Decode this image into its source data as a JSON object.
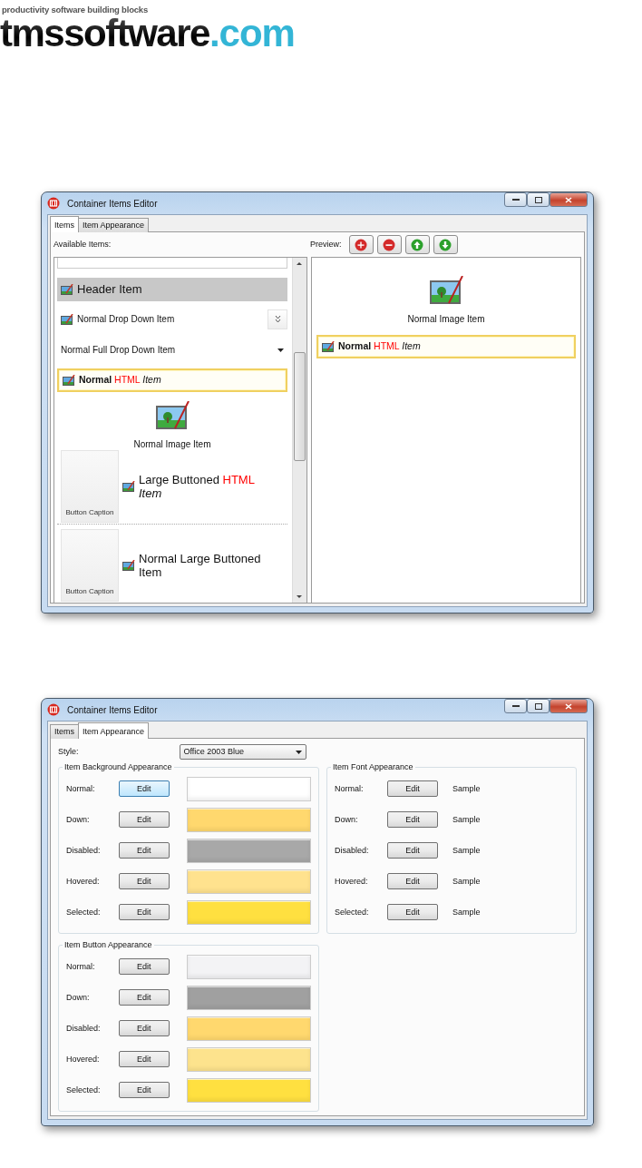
{
  "logo": {
    "tagline": "productivity software building blocks",
    "name": "tmssoftware",
    "suffix": ".com"
  },
  "windows": [
    {
      "kind": "items",
      "title": "Container Items Editor",
      "tabs": [
        {
          "label": "Items",
          "selected": true
        },
        {
          "label": "Item Appearance",
          "selected": false
        }
      ],
      "available_label": "Available Items:",
      "preview_label": "Preview:",
      "preview_buttons": [
        {
          "kind": "add"
        },
        {
          "kind": "remove"
        },
        {
          "kind": "up"
        },
        {
          "kind": "down"
        }
      ],
      "list_items": [
        {
          "kind": "header",
          "selected": false,
          "parts": [
            {
              "text": "Header Item"
            }
          ]
        },
        {
          "kind": "dropdown",
          "selected": false,
          "parts": [
            {
              "text": "Normal Drop Down Item"
            }
          ]
        },
        {
          "kind": "full-dropdown",
          "selected": false,
          "parts": [
            {
              "text": "Normal Full Drop Down Item"
            }
          ]
        },
        {
          "kind": "text",
          "selected": true,
          "parts": [
            {
              "text": "**Normal**"
            },
            {
              "text": "HTML",
              "color": "#ff0000"
            },
            {
              "text": "*Item*"
            }
          ]
        },
        {
          "kind": "image",
          "selected": false,
          "parts": [
            {
              "text": "Normal Image Item"
            }
          ]
        },
        {
          "kind": "large-button",
          "selected": false,
          "caption": "Button Caption",
          "parts": [
            {
              "text": "Large Buttoned"
            },
            {
              "text": "HTML",
              "color": "#ff0000"
            },
            {
              "text": "*Item*"
            }
          ]
        },
        {
          "kind": "large-button",
          "selected": false,
          "caption": "Button Caption",
          "parts": [
            {
              "text": "Normal Large Buttoned Item"
            }
          ]
        }
      ],
      "preview_items": [
        {
          "kind": "image",
          "selected": false,
          "parts": [
            {
              "text": "Normal Image Item"
            }
          ]
        },
        {
          "kind": "text",
          "selected": true,
          "parts": [
            {
              "text": "**Normal**"
            },
            {
              "text": "HTML",
              "color": "#ff0000"
            },
            {
              "text": "*Item*"
            }
          ]
        }
      ]
    },
    {
      "kind": "appearance",
      "title": "Container Items Editor",
      "tabs": [
        {
          "label": "Items",
          "selected": false
        },
        {
          "label": "Item Appearance",
          "selected": true
        }
      ],
      "style_label": "Style:",
      "style_value": "Office 2003 Blue",
      "groups": [
        {
          "title": "Item Background Appearance",
          "kind": "swatch",
          "rows": [
            {
              "label": "Normal:",
              "button": "Edit",
              "focused": true,
              "color": "#ffffff"
            },
            {
              "label": "Down:",
              "button": "Edit",
              "focused": false,
              "color": "#ffd86e"
            },
            {
              "label": "Disabled:",
              "button": "Edit",
              "focused": false,
              "color": "#a8a8a8"
            },
            {
              "label": "Hovered:",
              "button": "Edit",
              "focused": false,
              "color": "#ffe28e"
            },
            {
              "label": "Selected:",
              "button": "Edit",
              "focused": false,
              "color": "#ffe040"
            }
          ]
        },
        {
          "title": "Item Font Appearance",
          "kind": "sample",
          "rows": [
            {
              "label": "Normal:",
              "button": "Edit",
              "focused": false,
              "sample": "Sample"
            },
            {
              "label": "Down:",
              "button": "Edit",
              "focused": false,
              "sample": "Sample"
            },
            {
              "label": "Disabled:",
              "button": "Edit",
              "focused": false,
              "sample": "Sample"
            },
            {
              "label": "Hovered:",
              "button": "Edit",
              "focused": false,
              "sample": "Sample"
            },
            {
              "label": "Selected:",
              "button": "Edit",
              "focused": false,
              "sample": "Sample"
            }
          ]
        },
        {
          "title": "Item Button Appearance",
          "kind": "swatch",
          "rows": [
            {
              "label": "Normal:",
              "button": "Edit",
              "focused": false,
              "color": "#f3f3f5"
            },
            {
              "label": "Down:",
              "button": "Edit",
              "focused": false,
              "color": "#a0a0a0"
            },
            {
              "label": "Disabled:",
              "button": "Edit",
              "focused": false,
              "color": "#ffd86e"
            },
            {
              "label": "Hovered:",
              "button": "Edit",
              "focused": false,
              "color": "#fde38d"
            },
            {
              "label": "Selected:",
              "button": "Edit",
              "focused": false,
              "color": "#ffe040"
            }
          ]
        }
      ]
    }
  ]
}
